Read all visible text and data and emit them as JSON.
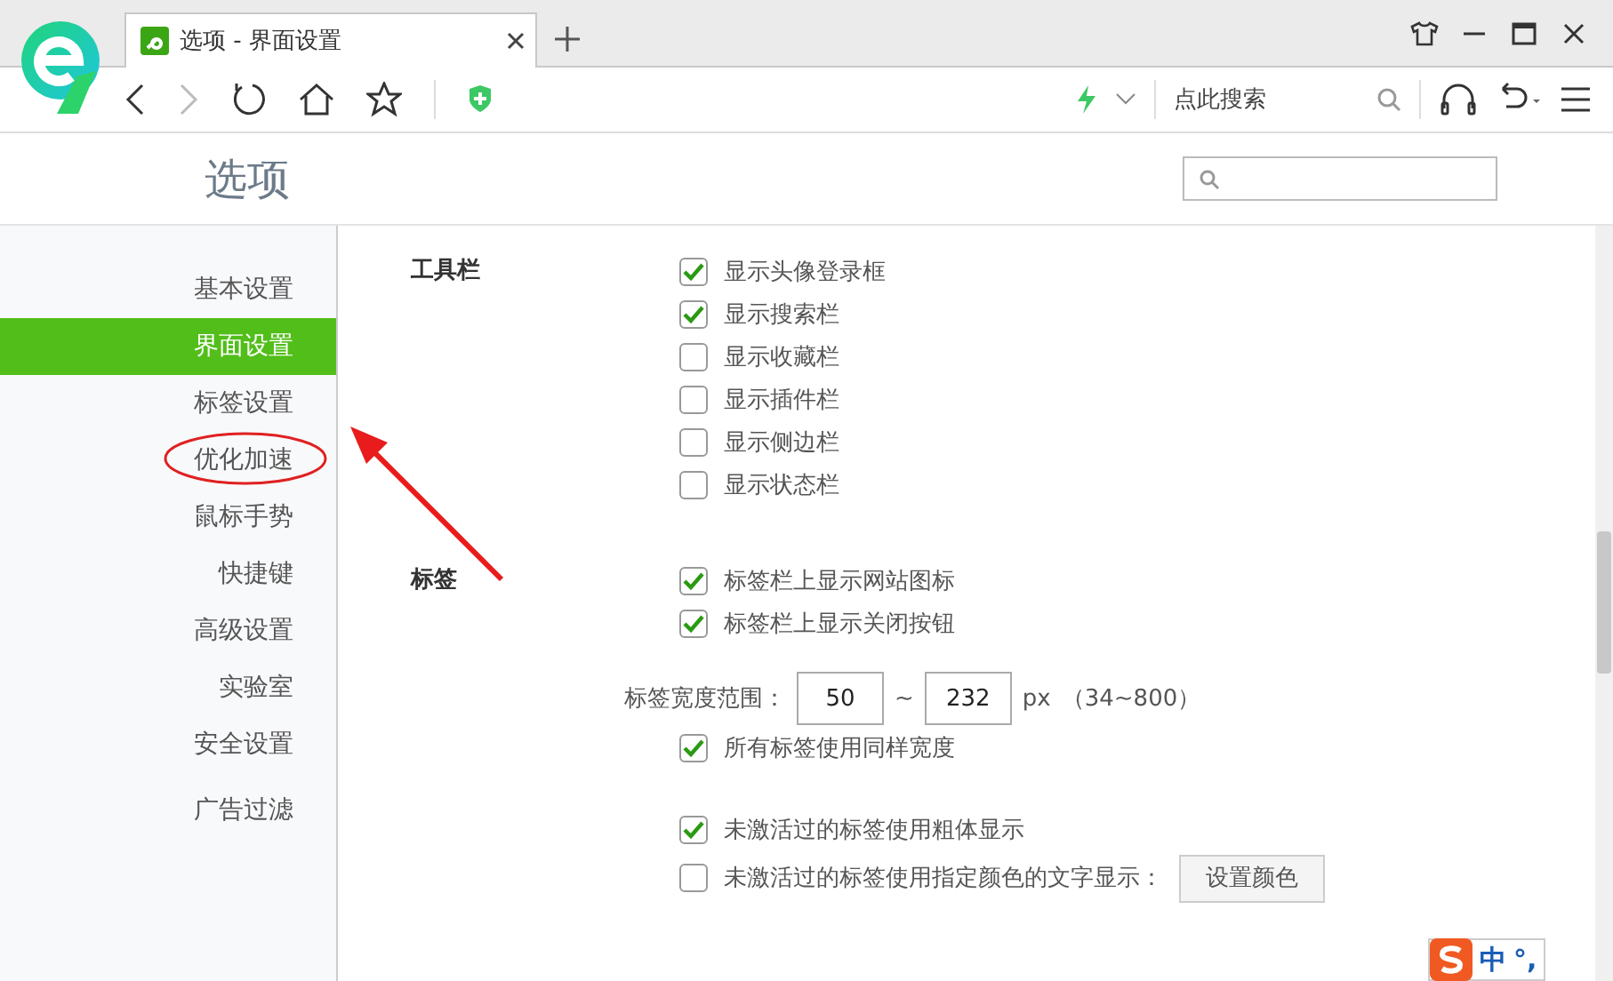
{
  "browser": {
    "tabs": [
      {
        "title": "选项 - 界面设置",
        "selected": true
      }
    ],
    "search": {
      "placeholder": "点此搜索"
    }
  },
  "page": {
    "title": "选项"
  },
  "sidebar": {
    "items": [
      {
        "label": "基本设置",
        "selected": false
      },
      {
        "label": "界面设置",
        "selected": true
      },
      {
        "label": "标签设置",
        "selected": false
      },
      {
        "label": "优化加速",
        "selected": false
      },
      {
        "label": "鼠标手势",
        "selected": false
      },
      {
        "label": "快捷键",
        "selected": false
      },
      {
        "label": "高级设置",
        "selected": false
      },
      {
        "label": "实验室",
        "selected": false
      },
      {
        "label": "安全设置",
        "selected": false
      },
      {
        "label": "广告过滤",
        "selected": false
      }
    ]
  },
  "sections": [
    {
      "heading": "工具栏",
      "rows": [
        {
          "kind": "checkbox",
          "label": "显示头像登录框",
          "checked": true
        },
        {
          "kind": "checkbox",
          "label": "显示搜索栏",
          "checked": true
        },
        {
          "kind": "checkbox",
          "label": "显示收藏栏",
          "checked": false
        },
        {
          "kind": "checkbox",
          "label": "显示插件栏",
          "checked": false
        },
        {
          "kind": "checkbox",
          "label": "显示侧边栏",
          "checked": false
        },
        {
          "kind": "checkbox",
          "label": "显示状态栏",
          "checked": false
        }
      ]
    },
    {
      "heading": "标签",
      "rows": [
        {
          "kind": "checkbox",
          "label": "标签栏上显示网站图标",
          "checked": true
        },
        {
          "kind": "checkbox",
          "label": "标签栏上显示关闭按钮",
          "checked": true
        },
        {
          "kind": "range",
          "label": "标签宽度范围：",
          "min": "50",
          "separator": "~",
          "max": "232",
          "unit": "px",
          "hint": "（34~800）"
        },
        {
          "kind": "checkbox",
          "label": "所有标签使用同样宽度",
          "checked": true
        },
        {
          "kind": "checkbox",
          "label": "未激活过的标签使用粗体显示",
          "checked": true,
          "gap_before": true
        },
        {
          "kind": "checkbox",
          "label": "未激活过的标签使用指定颜色的文字显示：",
          "checked": false,
          "button": "设置颜色"
        }
      ]
    }
  ],
  "annotations": {
    "circle": true,
    "arrow": true
  },
  "ime": {
    "mode": "中",
    "punct": "°,"
  }
}
